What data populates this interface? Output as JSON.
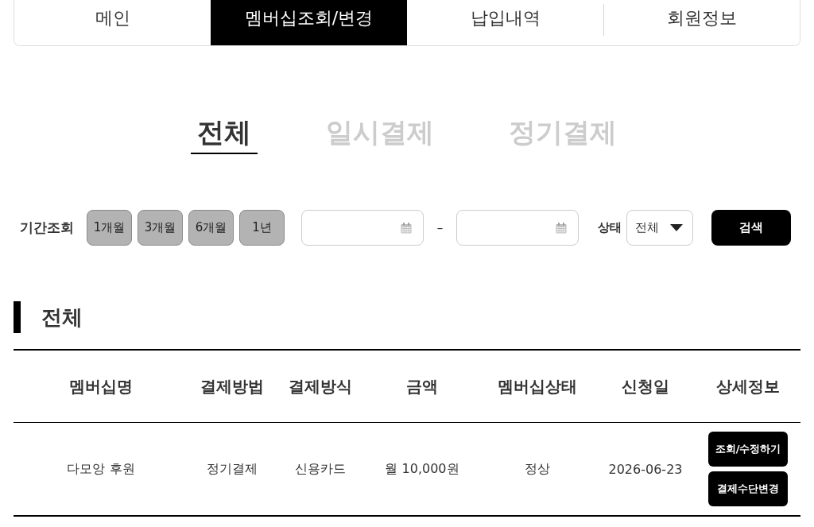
{
  "nav_tabs": [
    {
      "label": "메인",
      "selected": false
    },
    {
      "label": "멤버십조회/변경",
      "selected": true
    },
    {
      "label": "납입내역",
      "selected": false
    },
    {
      "label": "회원정보",
      "selected": false
    }
  ],
  "filter_tabs": [
    {
      "label": "전체",
      "selected": true
    },
    {
      "label": "일시결제",
      "selected": false
    },
    {
      "label": "정기결제",
      "selected": false
    }
  ],
  "period_filter": {
    "label": "기간조회",
    "buttons": [
      "1개월",
      "3개월",
      "6개월",
      "1년"
    ],
    "range_separator": "–"
  },
  "status_filter": {
    "label": "상태",
    "value": "전체"
  },
  "search_button": "검색",
  "section_title": "전체",
  "table": {
    "columns": [
      "멤버십명",
      "결제방법",
      "결제방식",
      "금액",
      "멤버십상태",
      "신청일",
      "상세정보"
    ],
    "rows": [
      {
        "cells": [
          "다모앙 후원",
          "정기결제",
          "신용카드",
          "월 10,000원",
          "정상",
          "2026-06-23"
        ],
        "actions": [
          "조회/수정하기",
          "결제수단변경"
        ]
      }
    ]
  }
}
